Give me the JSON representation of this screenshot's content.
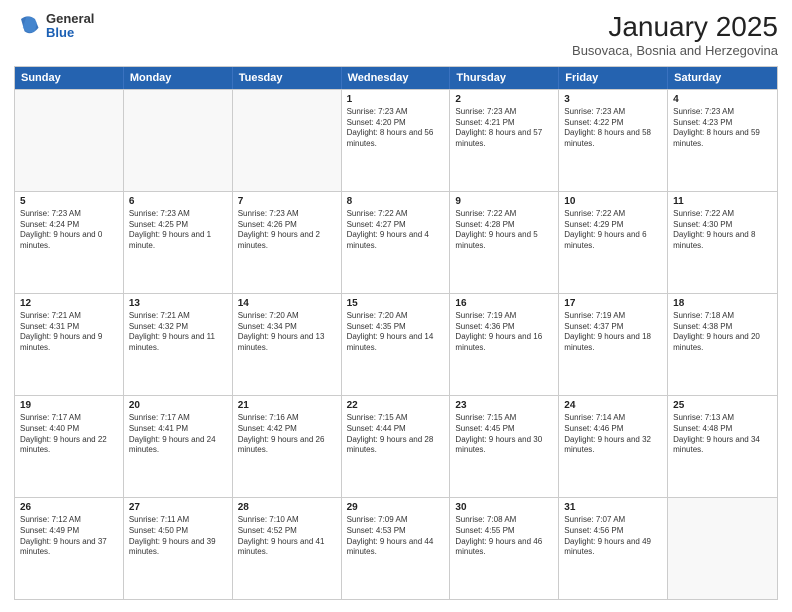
{
  "logo": {
    "general": "General",
    "blue": "Blue"
  },
  "header": {
    "month": "January 2025",
    "location": "Busovaca, Bosnia and Herzegovina"
  },
  "weekdays": [
    "Sunday",
    "Monday",
    "Tuesday",
    "Wednesday",
    "Thursday",
    "Friday",
    "Saturday"
  ],
  "rows": [
    [
      {
        "day": "",
        "text": ""
      },
      {
        "day": "",
        "text": ""
      },
      {
        "day": "",
        "text": ""
      },
      {
        "day": "1",
        "text": "Sunrise: 7:23 AM\nSunset: 4:20 PM\nDaylight: 8 hours and 56 minutes."
      },
      {
        "day": "2",
        "text": "Sunrise: 7:23 AM\nSunset: 4:21 PM\nDaylight: 8 hours and 57 minutes."
      },
      {
        "day": "3",
        "text": "Sunrise: 7:23 AM\nSunset: 4:22 PM\nDaylight: 8 hours and 58 minutes."
      },
      {
        "day": "4",
        "text": "Sunrise: 7:23 AM\nSunset: 4:23 PM\nDaylight: 8 hours and 59 minutes."
      }
    ],
    [
      {
        "day": "5",
        "text": "Sunrise: 7:23 AM\nSunset: 4:24 PM\nDaylight: 9 hours and 0 minutes."
      },
      {
        "day": "6",
        "text": "Sunrise: 7:23 AM\nSunset: 4:25 PM\nDaylight: 9 hours and 1 minute."
      },
      {
        "day": "7",
        "text": "Sunrise: 7:23 AM\nSunset: 4:26 PM\nDaylight: 9 hours and 2 minutes."
      },
      {
        "day": "8",
        "text": "Sunrise: 7:22 AM\nSunset: 4:27 PM\nDaylight: 9 hours and 4 minutes."
      },
      {
        "day": "9",
        "text": "Sunrise: 7:22 AM\nSunset: 4:28 PM\nDaylight: 9 hours and 5 minutes."
      },
      {
        "day": "10",
        "text": "Sunrise: 7:22 AM\nSunset: 4:29 PM\nDaylight: 9 hours and 6 minutes."
      },
      {
        "day": "11",
        "text": "Sunrise: 7:22 AM\nSunset: 4:30 PM\nDaylight: 9 hours and 8 minutes."
      }
    ],
    [
      {
        "day": "12",
        "text": "Sunrise: 7:21 AM\nSunset: 4:31 PM\nDaylight: 9 hours and 9 minutes."
      },
      {
        "day": "13",
        "text": "Sunrise: 7:21 AM\nSunset: 4:32 PM\nDaylight: 9 hours and 11 minutes."
      },
      {
        "day": "14",
        "text": "Sunrise: 7:20 AM\nSunset: 4:34 PM\nDaylight: 9 hours and 13 minutes."
      },
      {
        "day": "15",
        "text": "Sunrise: 7:20 AM\nSunset: 4:35 PM\nDaylight: 9 hours and 14 minutes."
      },
      {
        "day": "16",
        "text": "Sunrise: 7:19 AM\nSunset: 4:36 PM\nDaylight: 9 hours and 16 minutes."
      },
      {
        "day": "17",
        "text": "Sunrise: 7:19 AM\nSunset: 4:37 PM\nDaylight: 9 hours and 18 minutes."
      },
      {
        "day": "18",
        "text": "Sunrise: 7:18 AM\nSunset: 4:38 PM\nDaylight: 9 hours and 20 minutes."
      }
    ],
    [
      {
        "day": "19",
        "text": "Sunrise: 7:17 AM\nSunset: 4:40 PM\nDaylight: 9 hours and 22 minutes."
      },
      {
        "day": "20",
        "text": "Sunrise: 7:17 AM\nSunset: 4:41 PM\nDaylight: 9 hours and 24 minutes."
      },
      {
        "day": "21",
        "text": "Sunrise: 7:16 AM\nSunset: 4:42 PM\nDaylight: 9 hours and 26 minutes."
      },
      {
        "day": "22",
        "text": "Sunrise: 7:15 AM\nSunset: 4:44 PM\nDaylight: 9 hours and 28 minutes."
      },
      {
        "day": "23",
        "text": "Sunrise: 7:15 AM\nSunset: 4:45 PM\nDaylight: 9 hours and 30 minutes."
      },
      {
        "day": "24",
        "text": "Sunrise: 7:14 AM\nSunset: 4:46 PM\nDaylight: 9 hours and 32 minutes."
      },
      {
        "day": "25",
        "text": "Sunrise: 7:13 AM\nSunset: 4:48 PM\nDaylight: 9 hours and 34 minutes."
      }
    ],
    [
      {
        "day": "26",
        "text": "Sunrise: 7:12 AM\nSunset: 4:49 PM\nDaylight: 9 hours and 37 minutes."
      },
      {
        "day": "27",
        "text": "Sunrise: 7:11 AM\nSunset: 4:50 PM\nDaylight: 9 hours and 39 minutes."
      },
      {
        "day": "28",
        "text": "Sunrise: 7:10 AM\nSunset: 4:52 PM\nDaylight: 9 hours and 41 minutes."
      },
      {
        "day": "29",
        "text": "Sunrise: 7:09 AM\nSunset: 4:53 PM\nDaylight: 9 hours and 44 minutes."
      },
      {
        "day": "30",
        "text": "Sunrise: 7:08 AM\nSunset: 4:55 PM\nDaylight: 9 hours and 46 minutes."
      },
      {
        "day": "31",
        "text": "Sunrise: 7:07 AM\nSunset: 4:56 PM\nDaylight: 9 hours and 49 minutes."
      },
      {
        "day": "",
        "text": ""
      }
    ]
  ]
}
